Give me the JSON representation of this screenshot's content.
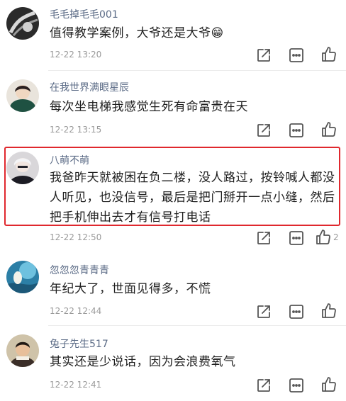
{
  "comments": [
    {
      "username": "毛毛掉毛毛001",
      "text": "值得教学案例，大爷还是大爷",
      "emoji": "😁",
      "time": "12-22 13:20",
      "likes": ""
    },
    {
      "username": "在我世界满眼星辰",
      "text": "每次坐电梯我感觉生死有命富贵在天",
      "emoji": "",
      "time": "12-22 13:15",
      "likes": ""
    },
    {
      "username": "八萌不萌",
      "text": "我爸昨天就被困在负二楼，没人路过，按铃喊人都没人听见，也没信号，最后是把门掰开一点小缝，然后把手机伸出去才有信号打电话",
      "emoji": "",
      "time": "12-22 12:50",
      "likes": "2"
    },
    {
      "username": "忽忽忽青青青",
      "text": "年纪大了，世面见得多，不慌",
      "emoji": "",
      "time": "12-22 12:44",
      "likes": ""
    },
    {
      "username": "兔子先生517",
      "text": "其实还是少说话，因为会浪费氧气",
      "emoji": "",
      "time": "12-22 12:41",
      "likes": ""
    }
  ],
  "icons": {
    "reply": "share-edit-icon",
    "more": "more-dots-icon",
    "like": "thumbs-up-icon"
  },
  "colors": {
    "username": "#5b6b86",
    "text": "#1f1f1f",
    "meta": "#9a9a9a",
    "highlight_border": "#e0282e"
  }
}
